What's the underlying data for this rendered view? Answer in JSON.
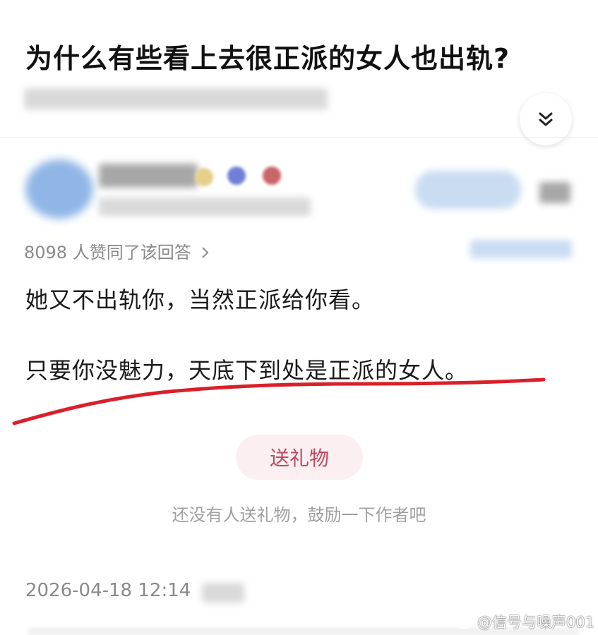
{
  "question": {
    "title": "为什么有些看上去很正派的女人也出轨?"
  },
  "answer": {
    "likes_text": "8098 人赞同了该回答",
    "paragraphs": [
      "她又不出轨你，当然正派给你看。",
      "只要你没魅力，天底下到处是正派的女人。"
    ],
    "underline_color": "#d9202a"
  },
  "gift": {
    "button_label": "送礼物",
    "hint": "还没有人送礼物，鼓励一下作者吧"
  },
  "footer": {
    "timestamp": "2026-04-18 12:14"
  },
  "watermark": {
    "text": "@信号与噪声001"
  },
  "icons": {
    "expand": "double-chevron-down-icon",
    "likes_arrow": "chevron-right-icon",
    "watermark_logo": "weibo-icon"
  },
  "colors": {
    "gift_text": "#c0485c",
    "gift_bg": "#fbeff1"
  }
}
